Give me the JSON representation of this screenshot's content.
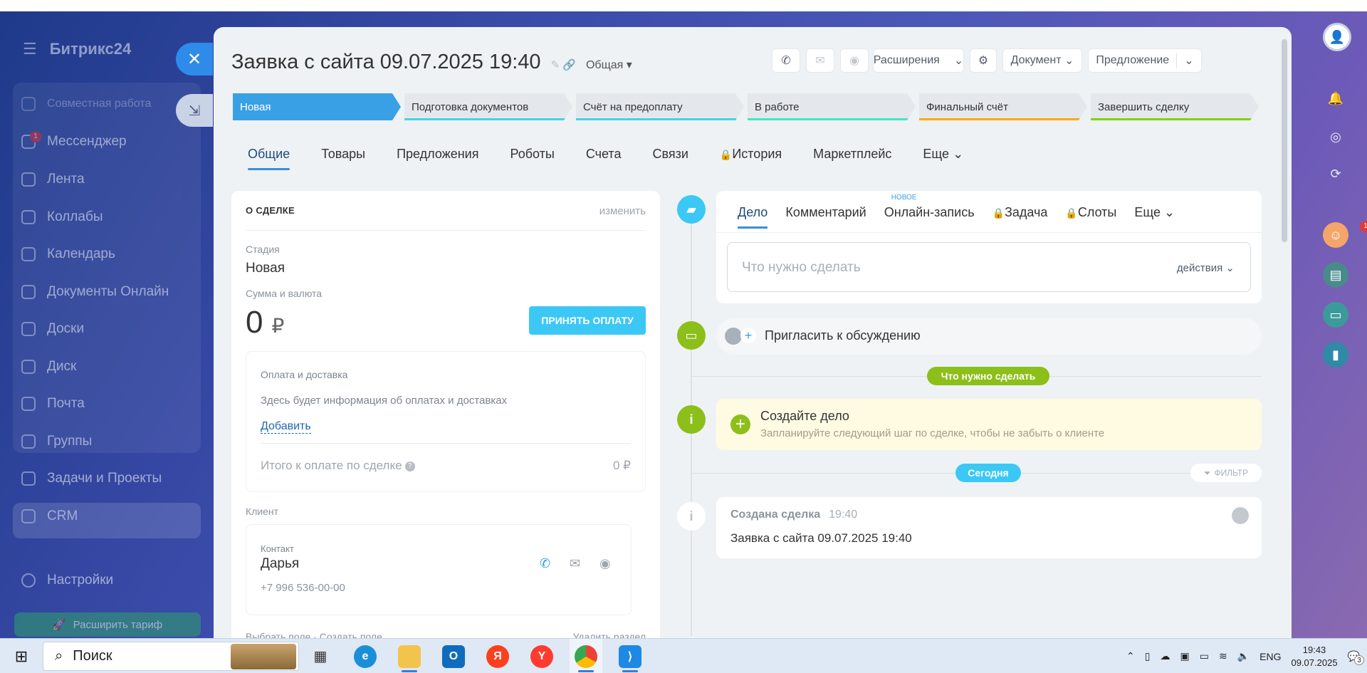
{
  "app": {
    "logo": "Битрикс24"
  },
  "sidebar": {
    "items": [
      {
        "label": "Совместная работа"
      },
      {
        "label": "Мессенджер",
        "badge": "1"
      },
      {
        "label": "Лента"
      },
      {
        "label": "Коллабы"
      },
      {
        "label": "Календарь"
      },
      {
        "label": "Документы Онлайн"
      },
      {
        "label": "Доски"
      },
      {
        "label": "Диск"
      },
      {
        "label": "Почта"
      },
      {
        "label": "Группы"
      },
      {
        "label": "Задачи и Проекты"
      },
      {
        "label": "CRM"
      },
      {
        "label": "Настройки"
      }
    ],
    "tariff_label": "Расширить тариф"
  },
  "deal": {
    "title": "Заявка с сайта 09.07.2025 19:40",
    "category": "Общая",
    "header_buttons": {
      "extensions": "Расширения",
      "document": "Документ",
      "offer": "Предложение"
    },
    "stages": [
      {
        "label": "Новая",
        "color": "#3aa0e6"
      },
      {
        "label": "Подготовка документов",
        "color": "#47d1e2"
      },
      {
        "label": "Счёт на предоплату",
        "color": "#47d1e2"
      },
      {
        "label": "В работе",
        "color": "#47e4c2"
      },
      {
        "label": "Финальный счёт",
        "color": "#ffa900"
      },
      {
        "label": "Завершить сделку",
        "color": "#7bd500"
      }
    ],
    "tabs": [
      "Общие",
      "Товары",
      "Предложения",
      "Роботы",
      "Счета",
      "Связи",
      "История",
      "Маркетплейс",
      "Еще"
    ]
  },
  "about": {
    "heading": "О СДЕЛКЕ",
    "edit": "изменить",
    "stage_label": "Стадия",
    "stage_value": "Новая",
    "sum_label": "Сумма и валюта",
    "amount": "0",
    "currency": "₽",
    "pay_button": "ПРИНЯТЬ ОПЛАТУ",
    "payment": {
      "title": "Оплата и доставка",
      "info": "Здесь будет информация об оплатах и доставках",
      "add": "Добавить",
      "total_label": "Итого к оплате по сделке",
      "total_value": "0 ₽"
    },
    "client_label": "Клиент",
    "contact": {
      "label": "Контакт",
      "name": "Дарья",
      "phone": "+7 996 536-00-00"
    },
    "footer": {
      "select_field": "Выбрать поле",
      "create_field": "Создать поле",
      "delete_section": "Удалить раздел"
    }
  },
  "timeline": {
    "editor_tabs": [
      "Дело",
      "Комментарий",
      "Онлайн-запись",
      "Задача",
      "Слоты",
      "Еще"
    ],
    "new_tag": "НОВОЕ",
    "placeholder": "Что нужно сделать",
    "actions": "действия",
    "invite": "Пригласить к обсуждению",
    "todo_pill": "Что нужно сделать",
    "todo_title": "Создайте дело",
    "todo_desc": "Запланируйте следующий шаг по сделке, чтобы не забыть о клиенте",
    "today_pill": "Сегодня",
    "filter": "ФИЛЬТР",
    "created_title": "Создана сделка",
    "created_time": "19:40",
    "created_body": "Заявка с сайта 09.07.2025 19:40"
  },
  "rightbar": {
    "avatar_badge": "1"
  },
  "taskbar": {
    "search": "Поиск",
    "lang": "ENG",
    "time": "19:43",
    "date": "09.07.2025",
    "notif_count": "3"
  },
  "colors": {
    "accent": "#3aa0e6",
    "green": "#8cbf1a",
    "pay": "#3bc8f5"
  }
}
